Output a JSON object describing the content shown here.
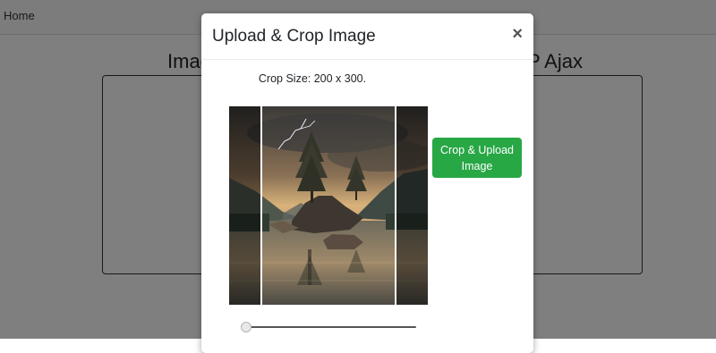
{
  "navbar": {
    "home_label": "Home"
  },
  "background": {
    "heading_left": "Imag",
    "heading_right": "P Ajax"
  },
  "modal": {
    "title": "Upload & Crop Image",
    "close_label": "×",
    "crop_size_text": "Crop Size: 200 x 300.",
    "upload_button_label": "Crop & Upload Image",
    "zoom_level": 0
  },
  "colors": {
    "primary_button": "#28a745",
    "overlay": "rgba(0,0,0,0.5)"
  }
}
